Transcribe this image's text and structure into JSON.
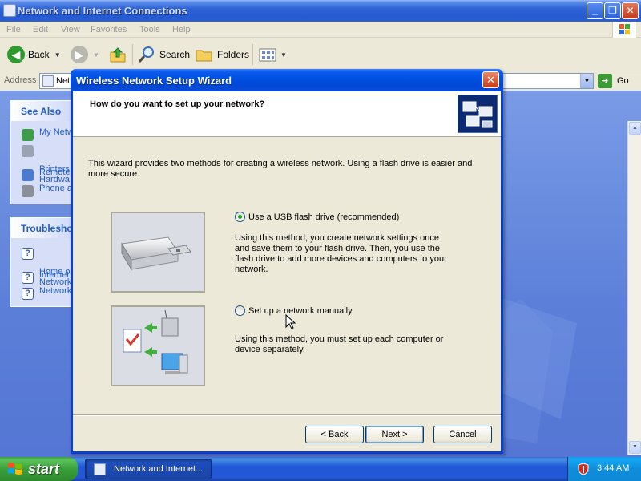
{
  "explorer": {
    "title": "Network and Internet Connections",
    "title_buttons": {
      "minimize": "_",
      "maximize": "❐",
      "close": "✕"
    },
    "menu": [
      "File",
      "Edit",
      "View",
      "Favorites",
      "Tools",
      "Help"
    ],
    "toolbar": {
      "back_label": "Back",
      "search_label": "Search",
      "folders_label": "Folders"
    },
    "address": {
      "label": "Address",
      "value": "Net",
      "go_label": "Go"
    },
    "see_also": {
      "heading": "See Also",
      "items": [
        "My Netw",
        "Printers\nHardwa",
        "Remote",
        "Phone a"
      ]
    },
    "troubleshooters": {
      "heading": "Troublesho",
      "items": [
        "Home or\nNetwork",
        "Internet",
        "Network"
      ]
    }
  },
  "wizard": {
    "title": "Wireless Network Setup Wizard",
    "close_glyph": "✕",
    "question": "How do you want to set up your network?",
    "intro": "This wizard provides two methods for creating a wireless network. Using a flash drive is easier and more secure.",
    "options": [
      {
        "label": "Use a USB flash drive (recommended)",
        "selected": true,
        "description": "Using this method, you create network settings once and save them to your flash drive. Then, you use the flash drive to add more devices and computers to your network."
      },
      {
        "label": "Set up a network manually",
        "selected": false,
        "description": "Using this method, you must set up each computer or device separately."
      }
    ],
    "buttons": {
      "back": "< Back",
      "next": "Next >",
      "cancel": "Cancel"
    }
  },
  "taskbar": {
    "start_label": "start",
    "task_label": "Network and Internet...",
    "clock": "3:44 AM"
  },
  "colors": {
    "xp_blue_title": "#0054e3",
    "xp_dialog_bg": "#ece9d8",
    "start_green": "#3a9f3a",
    "link_blue": "#215dc6",
    "radio_check_green": "#21a121"
  }
}
